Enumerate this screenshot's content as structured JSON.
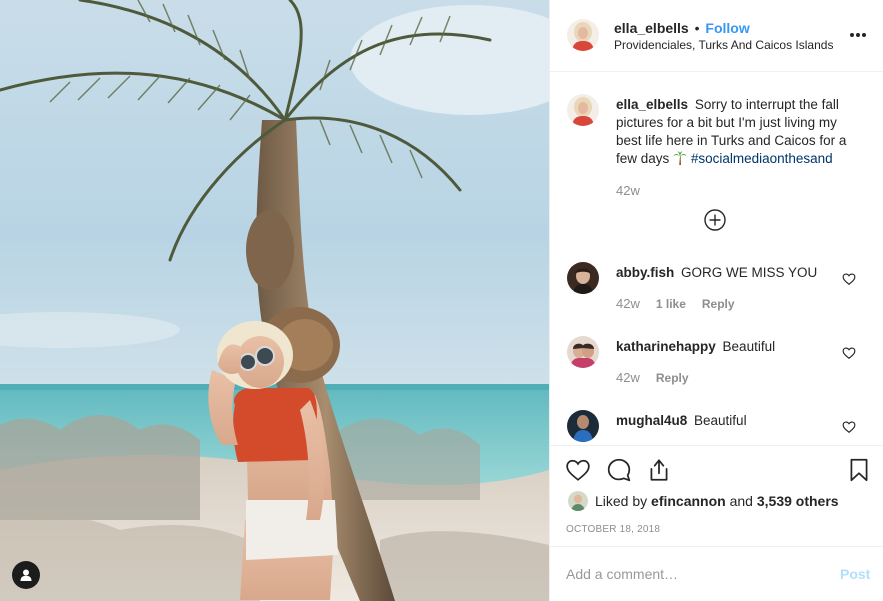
{
  "author": {
    "username": "ella_elbells",
    "separator": "•",
    "follow_label": "Follow",
    "location": "Providenciales, Turks And Caicos Islands"
  },
  "caption": {
    "username": "ella_elbells",
    "text": "Sorry to interrupt the fall pictures for a bit but I'm just living my best life here in Turks and Caicos for a few days",
    "emoji_icon": "palm-tree-emoji",
    "hashtag": "#socialmediaonthesand",
    "time": "42w"
  },
  "comments": [
    {
      "username": "abby.fish",
      "text": "GORG WE MISS YOU",
      "time": "42w",
      "likes": "1 like",
      "reply": "Reply"
    },
    {
      "username": "katharinehappy",
      "text": "Beautiful",
      "time": "42w",
      "likes": "",
      "reply": "Reply"
    },
    {
      "username": "mughal4u8",
      "text": "Beautiful",
      "time": "",
      "likes": "",
      "reply": ""
    }
  ],
  "likes": {
    "prefix": "Liked by",
    "user": "efincannon",
    "conjunction": "and",
    "others": "3,539 others"
  },
  "date": "OCTOBER 18, 2018",
  "comment_box": {
    "placeholder": "Add a comment…",
    "post_label": "Post"
  },
  "icons": {
    "more": "more-options-icon",
    "load_more": "load-more-comments-icon",
    "like": "heart-icon",
    "comment": "comment-icon",
    "share": "share-icon",
    "save": "bookmark-icon",
    "tags": "user-tag-icon"
  },
  "colors": {
    "link_blue": "#3897f0",
    "hashtag": "#003569",
    "muted": "#8e8e8e",
    "post_disabled": "#b2dffc"
  }
}
